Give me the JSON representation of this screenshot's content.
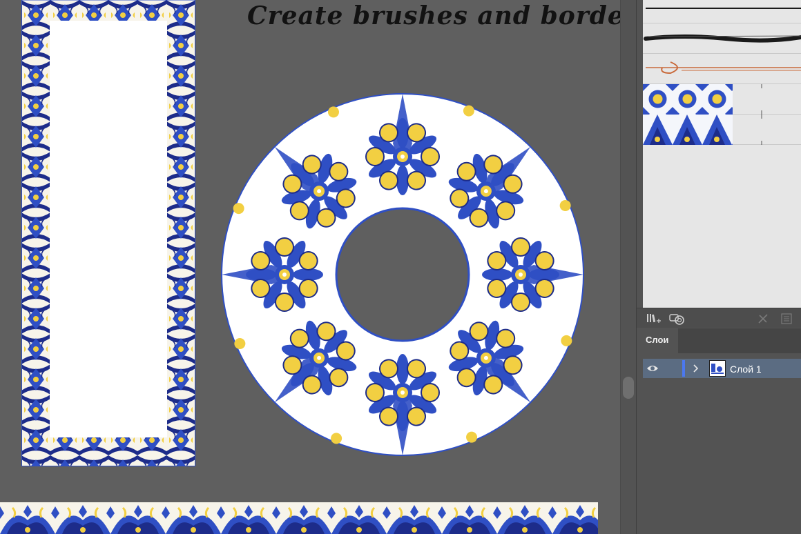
{
  "canvas": {
    "title": "Create brushes and borders"
  },
  "layers_panel": {
    "tab_label": "Слои",
    "layer_name": "Слой 1"
  },
  "colors": {
    "canvas_bg": "#5f5f5f",
    "panel_bg": "#535353",
    "tile_blue": "#2f4fc4",
    "tile_navy": "#1d2c8a",
    "tile_yellow": "#f2cf42",
    "tile_white": "#ffffff",
    "layer_highlight": "#5b6c82",
    "layer_color_bar": "#4b78f0"
  },
  "icons": {
    "brush_library": "brush-library-menu-icon",
    "cc_libraries": "creative-cloud-libraries-icon",
    "remove_stroke": "remove-brush-stroke-icon",
    "brush_options": "brush-options-icon",
    "visibility": "eye-icon",
    "expand": "chevron-right-icon"
  }
}
